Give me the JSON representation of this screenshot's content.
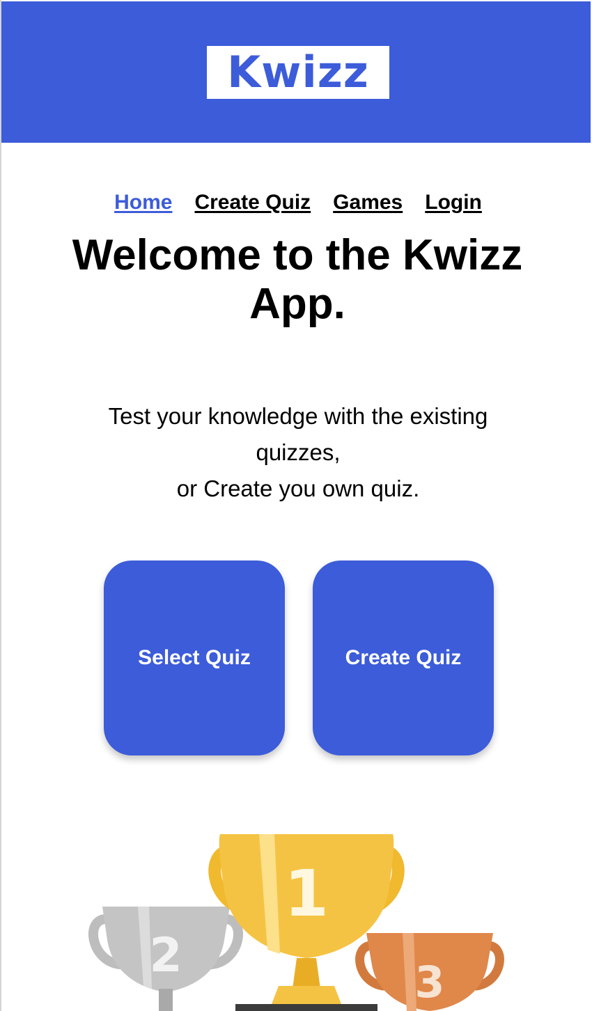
{
  "header": {
    "logo_text": "Kwizz",
    "background_color": "#3c5cd9"
  },
  "nav": {
    "items": [
      {
        "label": "Home",
        "active": true
      },
      {
        "label": "Create Quiz",
        "active": false
      },
      {
        "label": "Games",
        "active": false
      },
      {
        "label": "Login",
        "active": false
      }
    ]
  },
  "main": {
    "title": "Welcome to the Kwizz App.",
    "subtitle_line1": "Test your knowledge with the existing quizzes,",
    "subtitle_line2": "or Create you own quiz.",
    "buttons": {
      "select_label": "Select Quiz",
      "create_label": "Create Quiz"
    }
  },
  "trophies": {
    "icon": "trophy-podium-icon",
    "first_label": "1",
    "second_label": "2",
    "third_label": "3",
    "colors": {
      "gold": "#f5c343",
      "silver": "#c4c4c4",
      "bronze": "#e0874a"
    }
  }
}
